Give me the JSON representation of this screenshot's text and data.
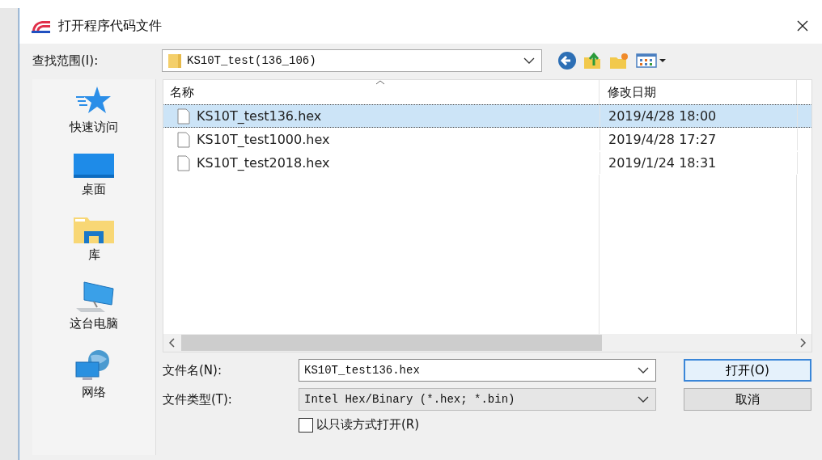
{
  "window": {
    "title": "打开程序代码文件"
  },
  "look_in": {
    "label": "查找范围(I):",
    "value": "KS10T_test(136_106)"
  },
  "places": [
    {
      "label": "快速访问",
      "kind": "star"
    },
    {
      "label": "桌面",
      "kind": "desktop"
    },
    {
      "label": "库",
      "kind": "library"
    },
    {
      "label": "这台电脑",
      "kind": "computer"
    },
    {
      "label": "网络",
      "kind": "network"
    }
  ],
  "table": {
    "columns": [
      "名称",
      "修改日期"
    ],
    "rows": [
      {
        "name": "KS10T_test136.hex",
        "modified": "2019/4/28 18:00",
        "selected": true
      },
      {
        "name": "KS10T_test1000.hex",
        "modified": "2019/4/28 17:27",
        "selected": false
      },
      {
        "name": "KS10T_test2018.hex",
        "modified": "2019/1/24 18:31",
        "selected": false
      }
    ]
  },
  "file_name": {
    "label": "文件名(N):",
    "value": "KS10T_test136.hex"
  },
  "file_type": {
    "label": "文件类型(T):",
    "value": "Intel Hex/Binary (*.hex; *.bin)"
  },
  "read_only": {
    "label": "以只读方式打开(R)",
    "checked": false
  },
  "buttons": [
    "打开(O)",
    "取消"
  ]
}
